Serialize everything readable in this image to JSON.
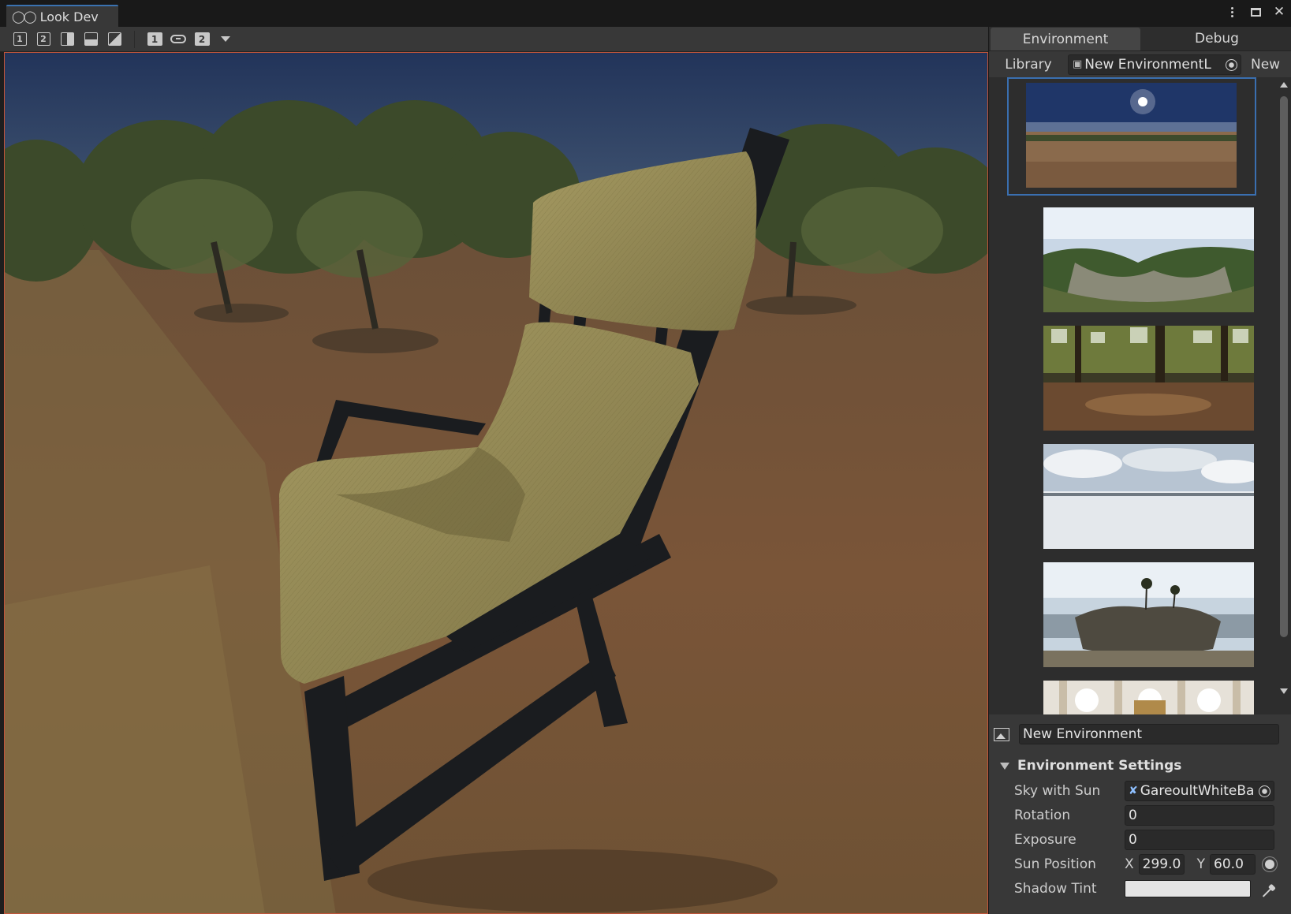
{
  "window": {
    "title": "Look Dev",
    "title_icon": "look-dev-icon"
  },
  "toolbar": {
    "buttons": [
      {
        "icon": "view-single-1-icon",
        "label": "1"
      },
      {
        "icon": "view-single-2-icon",
        "label": "2"
      },
      {
        "icon": "split-vertical-icon",
        "label": ""
      },
      {
        "icon": "split-horizontal-icon",
        "label": ""
      },
      {
        "icon": "split-diagonal-icon",
        "label": ""
      },
      {
        "icon": "environment-1-icon",
        "label": "1"
      },
      {
        "icon": "link-icon",
        "label": ""
      },
      {
        "icon": "environment-2-icon",
        "label": "2"
      },
      {
        "icon": "dropdown-caret-icon",
        "label": ""
      }
    ]
  },
  "panel": {
    "tabs": [
      {
        "label": "Environment",
        "active": true
      },
      {
        "label": "Debug",
        "active": false
      }
    ],
    "library": {
      "label": "Library",
      "field_value": "New EnvironmentL",
      "new_label": "New"
    },
    "thumbnails": [
      {
        "name": "desert-sun-hdri",
        "selected": true
      },
      {
        "name": "beach-hdri",
        "selected": false
      },
      {
        "name": "forest-hdri",
        "selected": false
      },
      {
        "name": "snow-field-hdri",
        "selected": false
      },
      {
        "name": "palm-island-hdri",
        "selected": false
      },
      {
        "name": "church-interior-hdri",
        "selected": false
      }
    ],
    "environment_name": "New Environment",
    "settings": {
      "header": "Environment Settings",
      "sky_label": "Sky with Sun",
      "sky_value": "GareoultWhiteBa",
      "rotation_label": "Rotation",
      "rotation_value": "0",
      "exposure_label": "Exposure",
      "exposure_value": "0",
      "sun_label": "Sun Position",
      "sun_x_axis": "X",
      "sun_x": "299.0",
      "sun_y_axis": "Y",
      "sun_y": "60.0",
      "shadow_label": "Shadow Tint",
      "shadow_color": "#e4e4e4"
    }
  },
  "colors": {
    "accent": "#3a72b0",
    "viewport_border": "#c2553b",
    "panel_bg": "#383838"
  }
}
